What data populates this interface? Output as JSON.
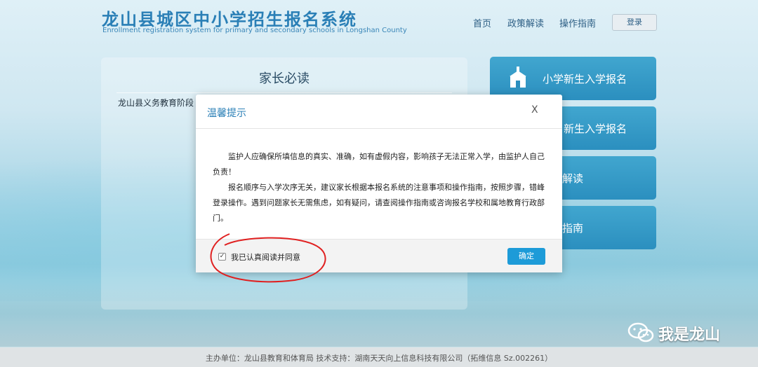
{
  "header": {
    "title_cn": "龙山县城区中小学招生报名系统",
    "title_en": "Enrollment registration system for primary and secondary schools in Longshan County",
    "nav": [
      "首页",
      "政策解读",
      "操作指南"
    ],
    "login_label": "登录"
  },
  "left_panel": {
    "title": "家长必读",
    "text": "龙山县义务教育阶段"
  },
  "side_buttons": [
    "小学新生入学报名",
    "新生入学报名",
    "解读",
    "指南"
  ],
  "modal": {
    "title": "温馨提示",
    "close_label": "X",
    "paragraph1": "监护人应确保所填信息的真实、准确，如有虚假内容，影响孩子无法正常入学，由监护人自己负责！",
    "paragraph2": "报名顺序与入学次序无关，建议家长根据本报名系统的注意事项和操作指南，按照步骤，错峰登录操作。遇到问题家长无需焦虑，如有疑问，请查阅操作指南或咨询报名学校和属地教育行政部门。",
    "agree_label": "我已认真阅读并同意",
    "agree_checked": true,
    "confirm_label": "确定"
  },
  "footer": {
    "text": "主办单位：龙山县教育和体育局    技术支持：湖南天天向上信息科技有限公司（拓维信息 Sz.002261）"
  },
  "watermark": {
    "text": "我是龙山",
    "icon": "wechat-icon"
  },
  "colors": {
    "brand": "#2a7fb6",
    "button": "#2b8fbf",
    "confirm": "#1d9bd8",
    "annotation": "#e02020"
  }
}
